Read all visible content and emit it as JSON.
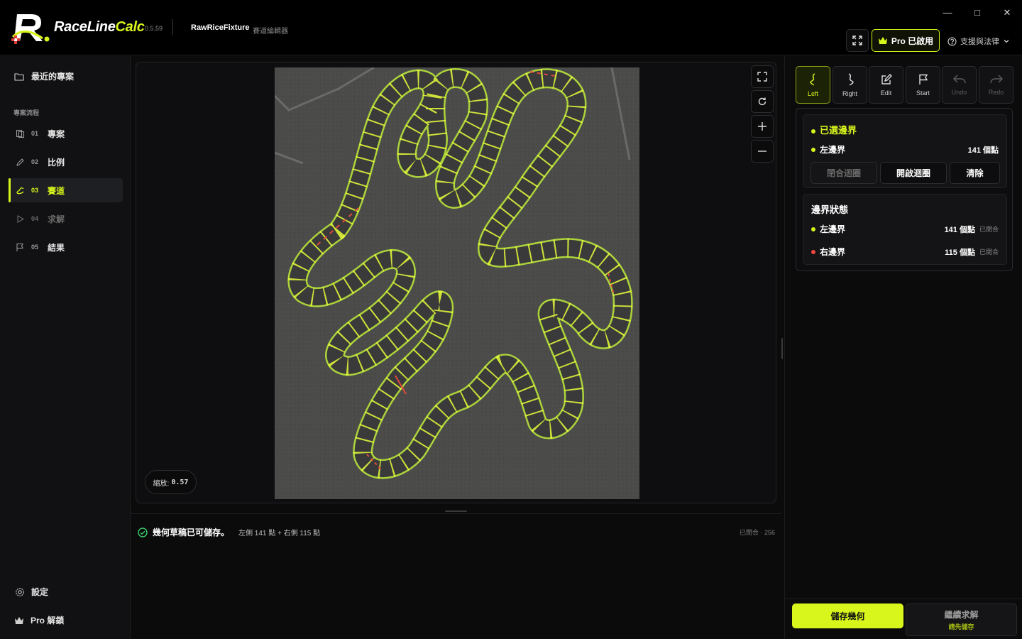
{
  "titlebar": {
    "brand_part1": "RaceLine",
    "brand_part2": "Calc",
    "version": "0.5.59",
    "project_name": "RawRiceFixture",
    "project_sub": "賽道編輯器",
    "pro_label": "Pro 已啟用",
    "support_label": "支援與法律",
    "minimize": "—",
    "maximize": "□",
    "close": "✕",
    "accent_color": "#d8f51c"
  },
  "sidebar": {
    "recent_label": "最近的專案",
    "section_label": "專案流程",
    "items": [
      {
        "num": "01",
        "label": "專案",
        "icon": "project-icon",
        "state": "normal"
      },
      {
        "num": "02",
        "label": "比例",
        "icon": "pencil-icon",
        "state": "normal"
      },
      {
        "num": "03",
        "label": "賽道",
        "icon": "track-icon",
        "state": "active"
      },
      {
        "num": "04",
        "label": "求解",
        "icon": "play-icon",
        "state": "disabled"
      },
      {
        "num": "05",
        "label": "結果",
        "icon": "flag-icon",
        "state": "normal"
      }
    ],
    "settings_label": "設定",
    "pro_unlock_label": "Pro 解鎖"
  },
  "canvas": {
    "zoom_label": "縮放:",
    "zoom_value": "0.57"
  },
  "status": {
    "message": "幾何草稿已可儲存。",
    "detail": "左側 141 點 + 右側 115 點",
    "right": "已閉合 · 256"
  },
  "modes": [
    {
      "label": "Left",
      "icon": "left-boundary-icon",
      "state": "active"
    },
    {
      "label": "Right",
      "icon": "right-boundary-icon",
      "state": "normal"
    },
    {
      "label": "Edit",
      "icon": "edit-icon",
      "state": "normal"
    },
    {
      "label": "Start",
      "icon": "flag-icon",
      "state": "normal"
    },
    {
      "label": "Undo",
      "icon": "undo-icon",
      "state": "disabled"
    },
    {
      "label": "Redo",
      "icon": "redo-icon",
      "state": "disabled"
    }
  ],
  "selected": {
    "title": "已選邊界",
    "boundary_label": "左邊界",
    "points": "141 個點",
    "close_loop": "閉合迴圈",
    "open_loop": "開啟迴圈",
    "clear": "清除"
  },
  "boundary_status": {
    "title": "邊界狀態",
    "left_label": "左邊界",
    "left_points": "141 個點",
    "left_state": "已閉合",
    "right_label": "右邊界",
    "right_points": "115 個點",
    "right_state": "已閉合",
    "left_color": "#d8f51c",
    "right_color": "#f0443c"
  },
  "actions": {
    "save": "儲存幾何",
    "continue": "繼續求解",
    "continue_sub": "請先儲存"
  }
}
